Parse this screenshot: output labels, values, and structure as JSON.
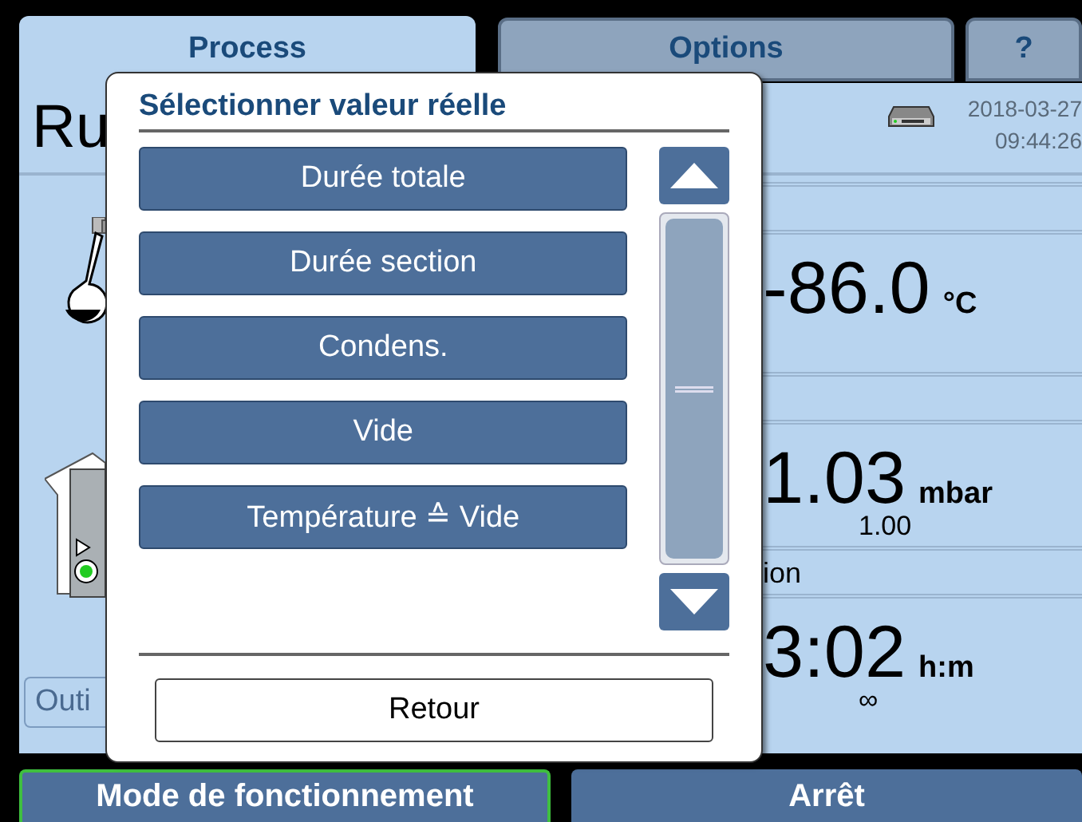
{
  "tabs": [
    {
      "label": "Process",
      "selected": true
    },
    {
      "label": "Options",
      "selected": false
    },
    {
      "label": "?",
      "selected": false
    }
  ],
  "header": {
    "mode_text": "Ru",
    "date": "2018-03-27",
    "time": "09:44:26"
  },
  "side_button": "Outi",
  "readings": [
    {
      "value": "-86.0",
      "unit": "°C"
    },
    {
      "value": "1.03",
      "unit": "mbar",
      "setpoint": "1.00"
    },
    {
      "label": "ion",
      "value": "3:02",
      "unit": "h:m",
      "setpoint": "∞"
    }
  ],
  "dialog": {
    "title": "Sélectionner valeur réelle",
    "options": [
      "Durée totale",
      "Durée section",
      "Condens.",
      "Vide",
      "Température ≙ Vide"
    ],
    "back_button": "Retour"
  },
  "bottom_buttons": [
    {
      "label": "Mode de fonctionnement",
      "selected": true
    },
    {
      "label": "Arrêt",
      "selected": false
    }
  ]
}
